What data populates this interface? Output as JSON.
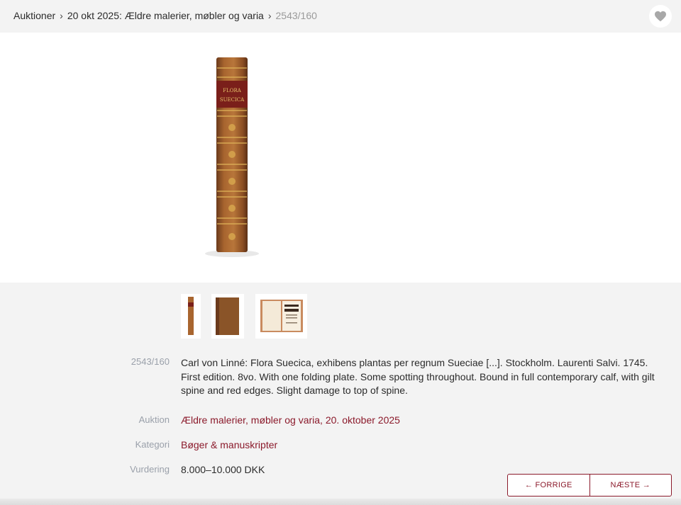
{
  "breadcrumb": {
    "items": [
      "Auktioner",
      "20 okt 2025: Ældre malerier, møbler og varia"
    ],
    "separator": "›",
    "current": "2543/160"
  },
  "favorite": {
    "icon": "heart-icon"
  },
  "gallery": {
    "main_image": "book-spine",
    "thumbnails": [
      "book-spine-thumb",
      "book-cover-thumb",
      "book-open-thumb"
    ]
  },
  "lot": {
    "number": "2543/160",
    "description": "Carl von Linné: Flora Suecica, exhibens plantas per regnum Sueciae [...]. Stockholm. Laurenti Salvi. 1745. First edition. 8vo. With one folding plate. Some spotting throughout. Bound in full contemporary calf, with gilt spine and red edges. Slight damage to top of spine.",
    "spine_title": [
      "FLORA",
      "SUECICA"
    ],
    "auction_label": "Auktion",
    "auction_value": "Ældre malerier, møbler og varia, 20. oktober 2025",
    "category_label": "Kategori",
    "category_value": "Bøger & manuskripter",
    "estimate_label": "Vurdering",
    "estimate_value": "8.000–10.000 DKK"
  },
  "navigation": {
    "prev_label": "← FORRIGE",
    "next_label": "NÆSTE →"
  },
  "colors": {
    "accent": "#8b1a2b",
    "muted": "#9aa0aa",
    "background": "#f3f3f3"
  }
}
